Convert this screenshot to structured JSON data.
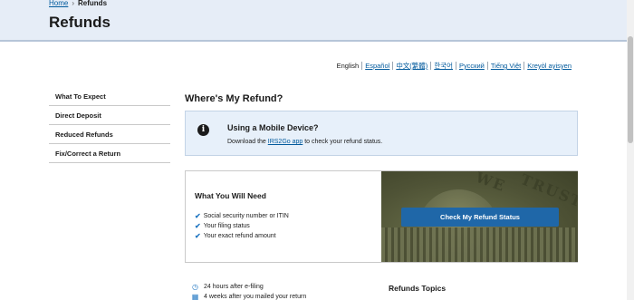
{
  "breadcrumb": {
    "home": "Home",
    "separator": "›",
    "current": "Refunds"
  },
  "page_title": "Refunds",
  "languages": [
    "English",
    "Español",
    "中文(繁體)",
    "한국어",
    "Русский",
    "Tiếng Việt",
    "Kreyòl ayisyen"
  ],
  "sidenav": {
    "items": [
      {
        "label": "What To Expect"
      },
      {
        "label": "Direct Deposit"
      },
      {
        "label": "Reduced Refunds"
      },
      {
        "label": "Fix/Correct a Return"
      }
    ]
  },
  "main": {
    "heading": "Where's My Refund?"
  },
  "alert": {
    "icon": "info-icon",
    "title": "Using a Mobile Device?",
    "text_before": "Download the ",
    "link": "IRS2Go app",
    "text_after": " to check your refund status."
  },
  "need": {
    "title": "What You Will Need",
    "items": [
      "Social security number or ITIN",
      "Your filing status",
      "Your exact refund amount"
    ],
    "button": "Check My Refund Status",
    "photo_text": [
      "WE",
      "TRUST"
    ]
  },
  "timeline": [
    {
      "icon": "clock-icon",
      "text": "24 hours after e-filing"
    },
    {
      "icon": "calendar-icon",
      "text": "4 weeks after you mailed your return"
    }
  ],
  "topics": {
    "title": "Refunds Topics"
  },
  "colors": {
    "header_bg": "#e6edf7",
    "link": "#00599c",
    "button": "#1f67a8",
    "check": "#2378c3"
  }
}
